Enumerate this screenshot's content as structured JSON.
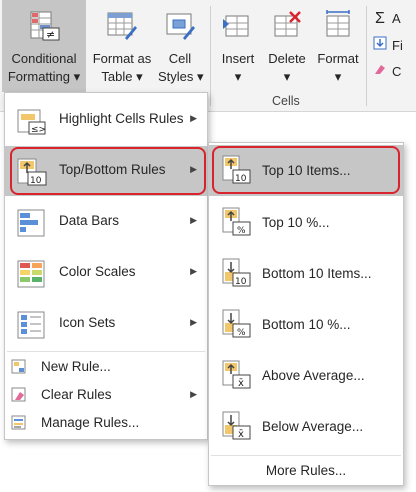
{
  "ribbon": {
    "conditional_formatting": {
      "line1": "Conditional",
      "line2": "Formatting ▾",
      "icon": "conditional-formatting-icon"
    },
    "format_as_table": {
      "line1": "Format as",
      "line2": "Table ▾",
      "icon": "format-as-table-icon"
    },
    "cell_styles": {
      "line1": "Cell",
      "line2": "Styles ▾",
      "icon": "cell-styles-icon"
    },
    "insert": {
      "line1": "Insert",
      "line2": "▾",
      "icon": "insert-cells-icon"
    },
    "delete": {
      "line1": "Delete",
      "line2": "▾",
      "icon": "delete-cells-icon"
    },
    "format": {
      "line1": "Format",
      "line2": "▾",
      "icon": "format-cells-icon"
    },
    "cells_group_label": "Cells",
    "side_commands": [
      {
        "label": "A",
        "icon": "autosum-icon"
      },
      {
        "label": "Fi",
        "icon": "fill-icon"
      },
      {
        "label": "C",
        "icon": "clear-icon"
      }
    ]
  },
  "menu": {
    "items": [
      {
        "label": "Highlight Cells Rules",
        "icon": "highlight-cells-rules-icon",
        "has_submenu": true
      },
      {
        "label": "Top/Bottom Rules",
        "icon": "top-bottom-rules-icon",
        "has_submenu": true,
        "selected": true
      },
      {
        "label": "Data Bars",
        "icon": "data-bars-icon",
        "has_submenu": true
      },
      {
        "label": "Color Scales",
        "icon": "color-scales-icon",
        "has_submenu": true
      },
      {
        "label": "Icon Sets",
        "icon": "icon-sets-icon",
        "has_submenu": true
      }
    ],
    "small_items": [
      {
        "label": "New Rule...",
        "icon": "new-rule-icon"
      },
      {
        "label": "Clear Rules",
        "icon": "clear-rules-icon",
        "has_submenu": true
      },
      {
        "label": "Manage Rules...",
        "icon": "manage-rules-icon"
      }
    ]
  },
  "submenu": {
    "items": [
      {
        "label": "Top 10 Items...",
        "icon": "top-10-items-icon",
        "badge": "10",
        "selected": true
      },
      {
        "label": "Top 10 %...",
        "icon": "top-10-percent-icon",
        "badge": "%"
      },
      {
        "label": "Bottom 10 Items...",
        "icon": "bottom-10-items-icon",
        "badge": "10"
      },
      {
        "label": "Bottom 10 %...",
        "icon": "bottom-10-percent-icon",
        "badge": "%"
      },
      {
        "label": "Above Average...",
        "icon": "above-average-icon",
        "badge": "x̄"
      },
      {
        "label": "Below Average...",
        "icon": "below-average-icon",
        "badge": "x̄"
      }
    ],
    "more_rules": "More Rules..."
  },
  "colors": {
    "highlight_border": "#d9232d",
    "selected_bg": "#c6c6c6",
    "ribbon_bg": "#f3f3f3"
  }
}
